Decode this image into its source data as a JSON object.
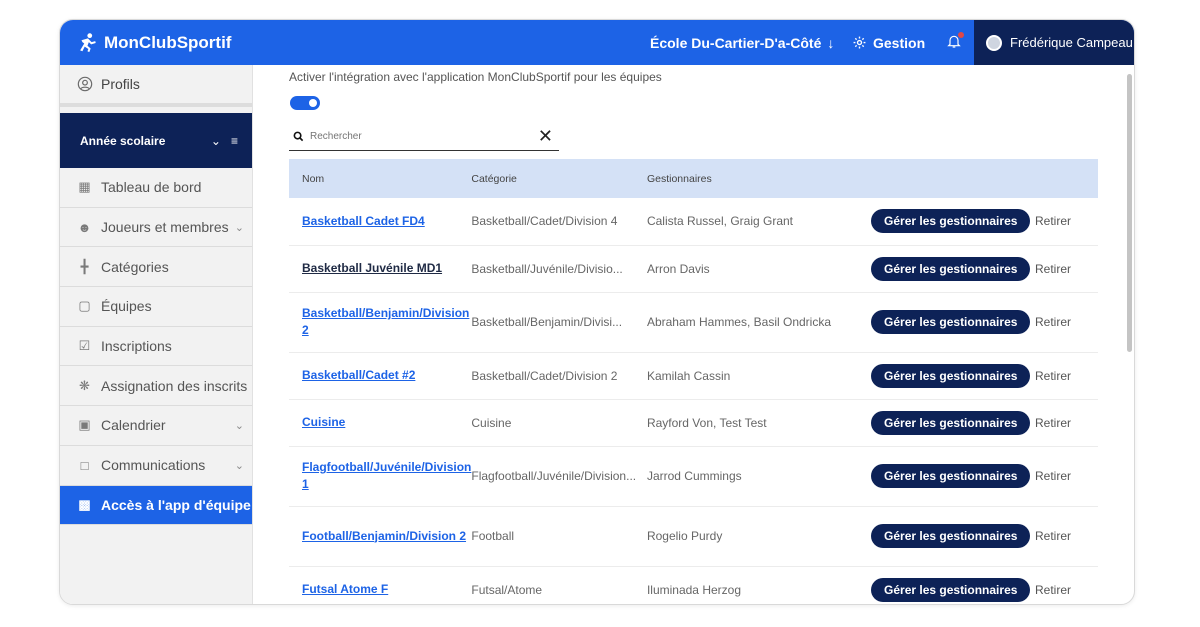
{
  "header": {
    "brand": "MonClubSportif",
    "school": "École Du-Cartier-D'a-Côté",
    "school_arrow": "↓",
    "gestion": "Gestion",
    "user_name": "Frédérique Campeau"
  },
  "sidebar": {
    "profil": "Profils",
    "annee": "Année scolaire",
    "items": [
      {
        "label": "Tableau de bord",
        "icon": "dashboard-icon",
        "chevron": false
      },
      {
        "label": "Joueurs et membres",
        "icon": "person-icon",
        "chevron": true
      },
      {
        "label": "Catégories",
        "icon": "hierarchy-icon",
        "chevron": false
      },
      {
        "label": "Équipes",
        "icon": "teams-icon",
        "chevron": false
      },
      {
        "label": "Inscriptions",
        "icon": "clipboard-icon",
        "chevron": false
      },
      {
        "label": "Assignation des inscrits",
        "icon": "network-icon",
        "chevron": false
      },
      {
        "label": "Calendrier",
        "icon": "calendar-icon",
        "chevron": true
      },
      {
        "label": "Communications",
        "icon": "chat-icon",
        "chevron": true
      },
      {
        "label": "Accès à l'app d'équipe",
        "icon": "app-access-icon",
        "chevron": false
      }
    ]
  },
  "main": {
    "integration_label": "Activer l'intégration avec l'application MonClubSportif pour les équipes",
    "integration_enabled": true,
    "search_placeholder": "Rechercher",
    "columns": [
      "Nom",
      "Catégorie",
      "Gestionnaires"
    ],
    "rows": [
      {
        "name": "Basketball Cadet FD4",
        "category": "Basketball/Cadet/Division 4",
        "managers": "Calista Russel, Graig Grant"
      },
      {
        "name": "Basketball Juvénile MD1",
        "category": "Basketball/Juvénile/Divisio...",
        "managers": "Arron Davis"
      },
      {
        "name": "Basketball/Benjamin/Division 2",
        "category": "Basketball/Benjamin/Divisi...",
        "managers": "Abraham Hammes, Basil Ondricka"
      },
      {
        "name": "Basketball/Cadet #2",
        "category": "Basketball/Cadet/Division 2",
        "managers": "Kamilah Cassin"
      },
      {
        "name": "Cuisine",
        "category": "Cuisine",
        "managers": "Rayford Von, Test Test"
      },
      {
        "name": "Flagfootball/Juvénile/Division 1",
        "category": "Flagfootball/Juvénile/Division...",
        "managers": "Jarrod Cummings"
      },
      {
        "name": "Football/Benjamin/Division 2",
        "category": "Football",
        "managers": "Rogelio Purdy"
      },
      {
        "name": "Futsal Atome F",
        "category": "Futsal/Atome",
        "managers": "Iluminada Herzog"
      }
    ],
    "manage_label": "Gérer les gestionnaires",
    "remove_label": "Retirer"
  },
  "colors": {
    "primary": "#1d63e6",
    "navy": "#0d2257",
    "header_row": "#d4e1f6"
  }
}
